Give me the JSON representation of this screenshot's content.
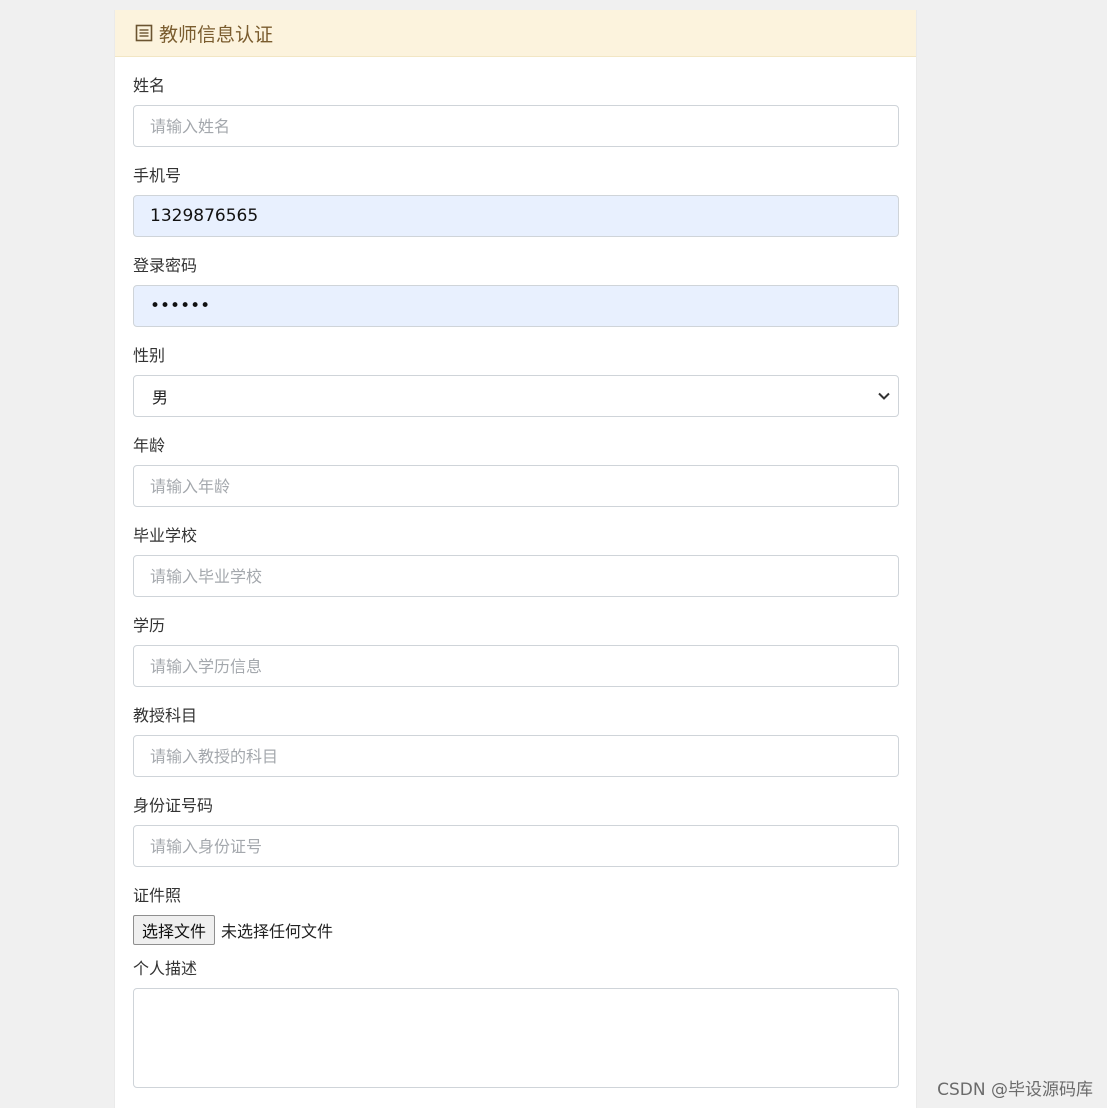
{
  "header": {
    "title": "教师信息认证",
    "icon": "list-icon"
  },
  "fields": {
    "name": {
      "label": "姓名",
      "placeholder": "请输入姓名"
    },
    "phone": {
      "label": "手机号",
      "value": "1329876565"
    },
    "password": {
      "label": "登录密码",
      "value": "••••••"
    },
    "gender": {
      "label": "性别",
      "selected": "男"
    },
    "age": {
      "label": "年龄",
      "placeholder": "请输入年龄"
    },
    "school": {
      "label": "毕业学校",
      "placeholder": "请输入毕业学校"
    },
    "education": {
      "label": "学历",
      "placeholder": "请输入学历信息"
    },
    "subject": {
      "label": "教授科目",
      "placeholder": "请输入教授的科目"
    },
    "idnumber": {
      "label": "身份证号码",
      "placeholder": "请输入身份证号"
    },
    "photo": {
      "label": "证件照",
      "button": "选择文件",
      "status": "未选择任何文件"
    },
    "description": {
      "label": "个人描述"
    }
  },
  "watermark": "CSDN @毕设源码库",
  "colors": {
    "header_bg": "#fcf3dd",
    "header_text": "#7a5c2e",
    "autofill_bg": "#e8f0fe"
  }
}
